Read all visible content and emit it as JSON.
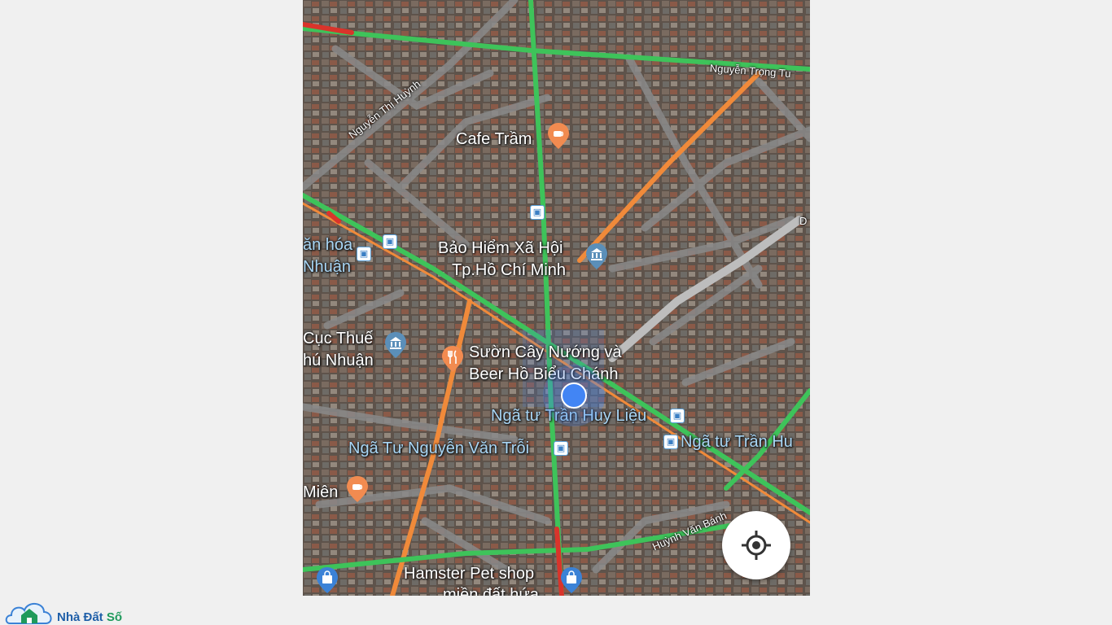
{
  "map": {
    "places": {
      "cafe_tram": "Cafe Trầm",
      "bao_hiem": "Bảo Hiểm Xã Hội",
      "bao_hiem_2": "Tp.Hồ Chí Minh",
      "suon": "Sườn Cây Nướng và",
      "suon_2": "Beer Hồ Biểu Chánh",
      "cuc_thue": "Cục Thuế",
      "cuc_thue_2": "hú Nhuận",
      "van_hoa": "ăn hóa",
      "van_hoa_2": "Nhuận",
      "mien": "Miên",
      "hamster": "Hamster Pet shop",
      "hamster_2": "miền đất hứa"
    },
    "transit": {
      "stop_1": "Ngã tư Trần Huy Liệu",
      "stop_2": "Ngã tư Trần Hu",
      "stop_3": "Ngã Tư Nguyễn Văn Trỗi"
    },
    "streets": {
      "nguyen_thi_huynh": "Nguyễn Thị Huỳnh",
      "nguyen_trong_tuyen": "Nguyễn Trọng Tu",
      "huynh_van_banh": "Huỳnh Văn Bánh",
      "edge_d": "D"
    },
    "pin_colors": {
      "food": "#f28b50",
      "gov": "#5b8fb9",
      "shop": "#3b82d6"
    },
    "traffic_colors": {
      "green": "#3ec35a",
      "orange": "#f08a3a",
      "red": "#d9342b"
    },
    "icons": [
      "coffee-icon",
      "restaurant-icon",
      "museum-icon",
      "shopping-bag-icon",
      "bus-icon",
      "my-location-icon"
    ]
  },
  "logo": {
    "brand": "Nhà Đất",
    "brand_suffix": "Số"
  }
}
